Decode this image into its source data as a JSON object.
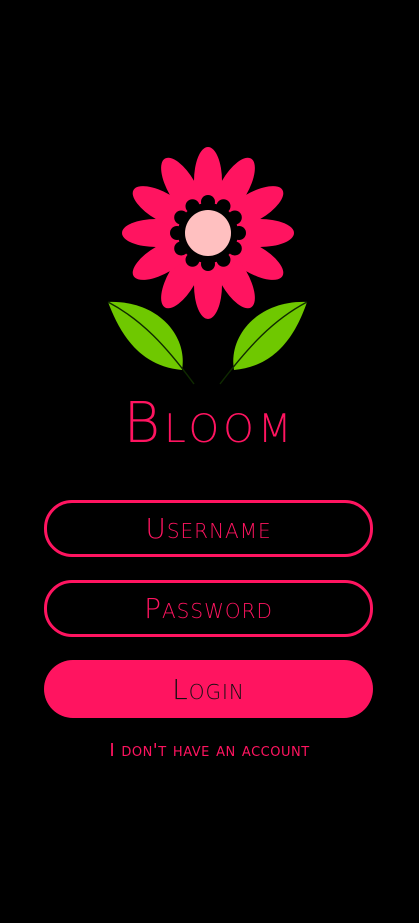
{
  "app": {
    "title": "Bloom",
    "logo": "flower-logo"
  },
  "colors": {
    "accent": "#ff1460",
    "background": "#000000",
    "leaf": "#6fc800",
    "flower_center": "#ffc0c0"
  },
  "login_form": {
    "username_placeholder": "Username",
    "password_placeholder": "Password",
    "login_label": "Login",
    "signup_link": "I don't have an account"
  }
}
